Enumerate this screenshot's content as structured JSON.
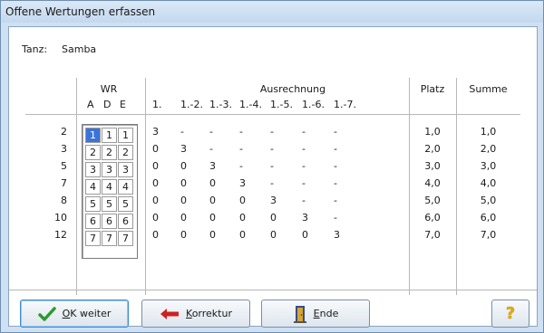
{
  "window": {
    "title": "Offene Wertungen erfassen"
  },
  "dance": {
    "label": "Tanz:",
    "value": "Samba"
  },
  "headers": {
    "wr": "WR",
    "wr_cols": [
      "A",
      "D",
      "E"
    ],
    "calc": "Ausrechnung",
    "calc_cols": [
      "1.",
      "1.-2.",
      "1.-3.",
      "1.-4.",
      "1.-5.",
      "1.-6.",
      "1.-7."
    ],
    "place": "Platz",
    "sum": "Summe"
  },
  "rows": [
    {
      "nr": "2",
      "wr": [
        "1",
        "1",
        "1"
      ],
      "calc": [
        "3",
        "-",
        "-",
        "-",
        "-",
        "-",
        "-"
      ],
      "place": "1,0",
      "sum": "1,0"
    },
    {
      "nr": "3",
      "wr": [
        "2",
        "2",
        "2"
      ],
      "calc": [
        "0",
        "3",
        "-",
        "-",
        "-",
        "-",
        "-"
      ],
      "place": "2,0",
      "sum": "2,0"
    },
    {
      "nr": "5",
      "wr": [
        "3",
        "3",
        "3"
      ],
      "calc": [
        "0",
        "0",
        "3",
        "-",
        "-",
        "-",
        "-"
      ],
      "place": "3,0",
      "sum": "3,0"
    },
    {
      "nr": "7",
      "wr": [
        "4",
        "4",
        "4"
      ],
      "calc": [
        "0",
        "0",
        "0",
        "3",
        "-",
        "-",
        "-"
      ],
      "place": "4,0",
      "sum": "4,0"
    },
    {
      "nr": "8",
      "wr": [
        "5",
        "5",
        "5"
      ],
      "calc": [
        "0",
        "0",
        "0",
        "0",
        "3",
        "-",
        "-"
      ],
      "place": "5,0",
      "sum": "5,0"
    },
    {
      "nr": "10",
      "wr": [
        "6",
        "6",
        "6"
      ],
      "calc": [
        "0",
        "0",
        "0",
        "0",
        "0",
        "3",
        "-"
      ],
      "place": "6,0",
      "sum": "6,0"
    },
    {
      "nr": "12",
      "wr": [
        "7",
        "7",
        "7"
      ],
      "calc": [
        "0",
        "0",
        "0",
        "0",
        "0",
        "0",
        "3"
      ],
      "place": "7,0",
      "sum": "7,0"
    }
  ],
  "buttons": {
    "ok": {
      "mnemonic": "O",
      "rest": "K weiter",
      "icon": "checkmark-icon",
      "color": "#2e9a2e"
    },
    "korrektur": {
      "mnemonic": "K",
      "rest": "orrektur",
      "icon": "arrow-left-icon",
      "color": "#d02020"
    },
    "ende": {
      "mnemonic": "E",
      "rest": "nde",
      "icon": "exit-door-icon",
      "color": "#3a4a8a"
    },
    "help": {
      "label": "?",
      "icon": "help-icon",
      "color": "#e0a800"
    }
  }
}
